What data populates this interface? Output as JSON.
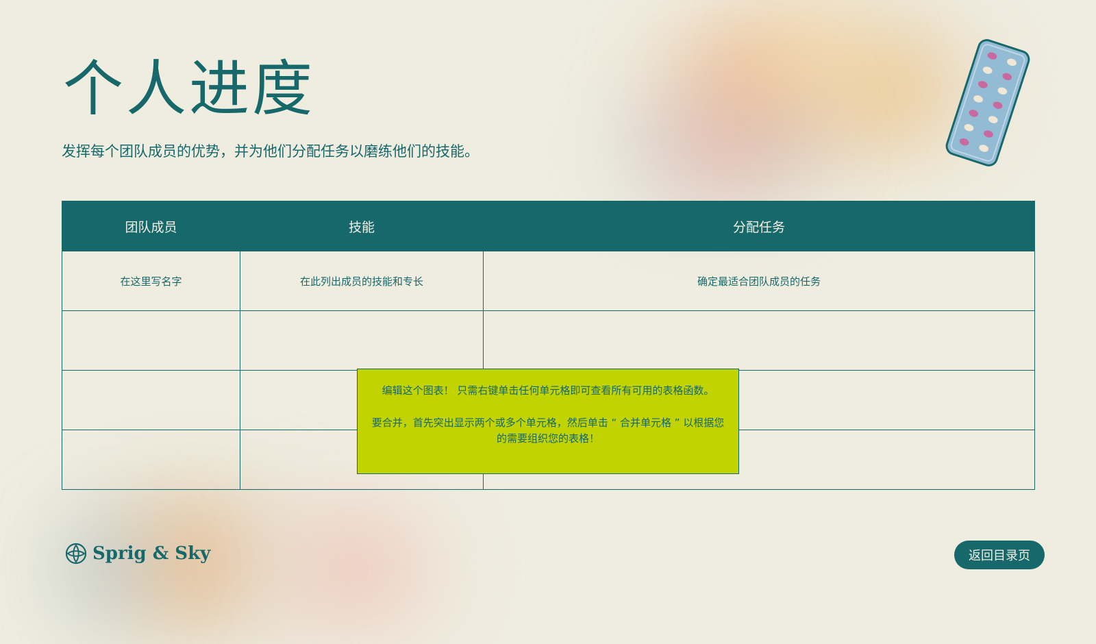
{
  "slide": {
    "title": "个人进度",
    "subtitle": "发挥每个团队成员的优势，并为他们分配任务以磨练他们的技能。"
  },
  "table": {
    "headers": [
      "团队成员",
      "技能",
      "分配任务"
    ],
    "rows": [
      [
        "在这里写名字",
        "在此列出成员的技能和专长",
        "确定最适合团队成员的任务"
      ],
      [
        "",
        "",
        ""
      ],
      [
        "",
        "",
        ""
      ],
      [
        "",
        "",
        ""
      ]
    ]
  },
  "note": {
    "line1": "编辑这个图表！ 只需右键单击任何单元格即可查看所有可用的表格函数。",
    "line2": "要合并，首先突出显示两个或多个单元格，然后单击 “ 合并单元格 ” 以根据您的需要组织您的表格！"
  },
  "brand": {
    "name": "Sprig & Sky",
    "icon": "leaf-flower-icon"
  },
  "back_button": {
    "label": "返回目录页"
  },
  "decor": {
    "icon": "pill-pack-icon"
  },
  "colors": {
    "background": "#efede0",
    "primary": "#17686b",
    "note": "#c1d301",
    "pill_blue": "#93bcd4",
    "pill_pink": "#c86aa0"
  }
}
